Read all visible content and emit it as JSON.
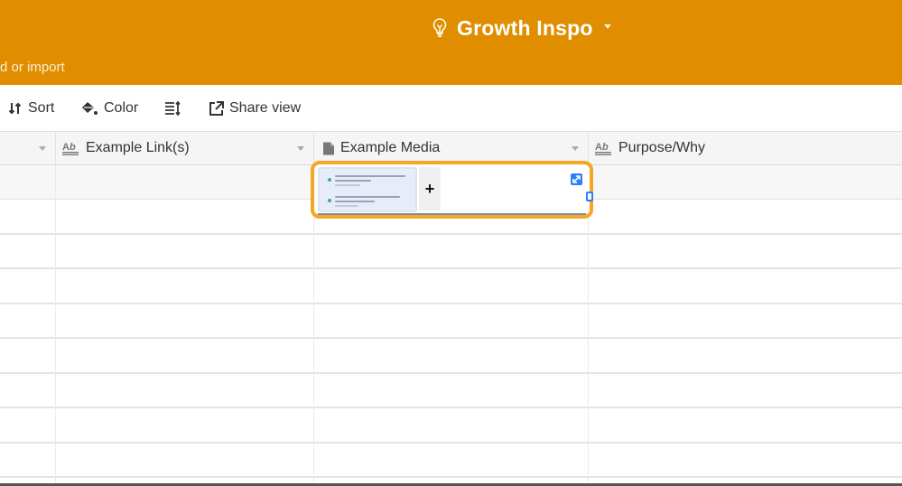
{
  "topbar": {
    "base_name": "Growth Inspo",
    "base_icon": "lightbulb-icon",
    "add_or_import": "d or import",
    "accent_color": "#e08e00"
  },
  "toolbar": {
    "sort_label": "Sort",
    "color_label": "Color",
    "row_height_icon": "row-height-icon",
    "share_view_label": "Share view"
  },
  "grid": {
    "columns": [
      {
        "name": "",
        "type": "unknown",
        "icon": ""
      },
      {
        "name": "Example Link(s)",
        "type": "text",
        "icon": "text-field-icon"
      },
      {
        "name": "Example Media",
        "type": "attachment",
        "icon": "attachment-field-icon"
      },
      {
        "name": "Purpose/Why",
        "type": "text",
        "icon": "text-field-icon"
      }
    ],
    "active_cell": {
      "column": "Example Media",
      "row": 1,
      "attachment_count": 1,
      "add_button": "+",
      "highlight_color": "#f5a623"
    },
    "row_count_visible": 9
  }
}
